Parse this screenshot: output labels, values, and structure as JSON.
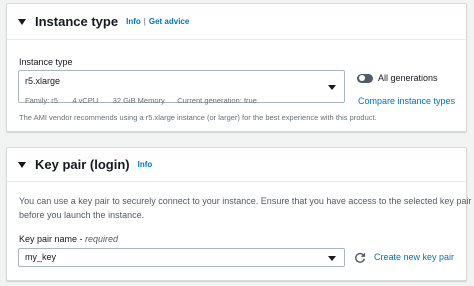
{
  "instance_type_panel": {
    "title": "Instance type",
    "info_link": "Info",
    "separator": "|",
    "advice_link": "Get advice",
    "field_label": "Instance type",
    "selected_value": "r5.xlarge",
    "details": {
      "family": "Family: r5",
      "vcpu": "4 vCPU",
      "memory": "32 GiB Memory",
      "generation": "Current generation: true"
    },
    "toggle_label": "All generations",
    "toggle_on": false,
    "compare_link": "Compare instance types",
    "recommendation": "The AMI vendor recommends using a r5.xlarge instance (or larger) for the best experience with this product."
  },
  "key_pair_panel": {
    "title": "Key pair (login)",
    "info_link": "Info",
    "description_line1": "You can use a key pair to securely connect to your instance. Ensure that you have access to the selected key pair",
    "description_line2": "before you launch the instance.",
    "field_label": "Key pair name - ",
    "field_required": "required",
    "selected_value": "my_key",
    "create_link": "Create new key pair"
  },
  "colors": {
    "link": "#0073bb",
    "toggle_off": "#545b64",
    "border": "#aab7b8",
    "background": "#f2f3f3"
  }
}
